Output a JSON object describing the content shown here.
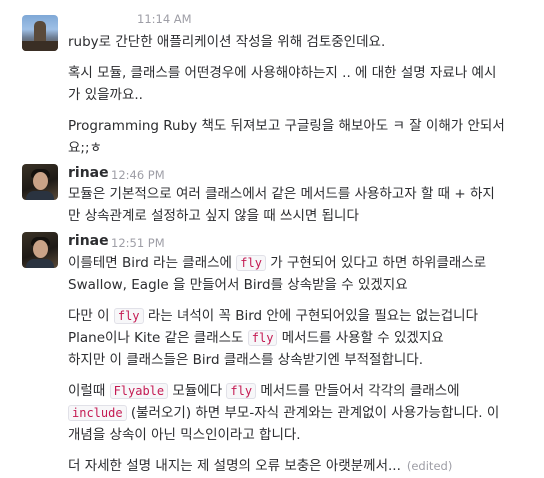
{
  "messages": [
    {
      "timestamp": "11:14 AM",
      "lines": [
        "ruby로 간단한 애플리케이션 작성을 위해 검토중인데요.",
        "혹시 모듈, 클래스를 어떤경우에 사용해야하는지 .. 에 대한 설명 자료나 예시",
        "가 있을까요..",
        "Programming Ruby 책도 뒤져보고 구글링을 해보아도 ㅋ 잘 이해가 안되서",
        "요;;ㅎ"
      ]
    },
    {
      "author": "rinae",
      "timestamp": "12:46 PM",
      "lines": [
        "모듈은 기본적으로 여러 클래스에서 같은 메서드를 사용하고자 할 때 + 하지",
        "만 상속관계로 설정하고 싶지 않을 때 쓰시면 됩니다"
      ]
    },
    {
      "author": "rinae",
      "timestamp": "12:51 PM",
      "l1": {
        "a": "이를테면 Bird 라는 클래스에 ",
        "code": "fly",
        "b": " 가 구현되어 있다고 하면 하위클래스로"
      },
      "l2": "Swallow, Eagle 을 만들어서 Bird를 상속받을 수 있겠지요",
      "l3": {
        "a": "다만 이 ",
        "code": "fly",
        "b": " 라는 녀석이 꼭 Bird 안에 구현되어있을 필요는 없는겁니다"
      },
      "l4": {
        "a": "Plane이나 Kite 같은 클래스도 ",
        "code": "fly",
        "b": " 메서드를 사용할 수 있겠지요"
      },
      "l5": "하지만 이 클래스들은 Bird 클래스를 상속받기엔 부적절합니다.",
      "l6": {
        "a": "이럴때 ",
        "code1": "Flyable",
        "b": " 모듈에다 ",
        "code2": "fly",
        "c": " 메서드를 만들어서 각각의 클래스에"
      },
      "l7": {
        "code": "include",
        "a": " (불러오기) 하면 부모-자식 관계와는 관계없이 사용가능합니다. 이"
      },
      "l8": "개념을 상속이 아닌 믹스인이라고 합니다.",
      "l9": "더 자세한 설명 내지는 제 설명의 오류 보충은 아랫분께서...",
      "edited": "(edited)"
    }
  ]
}
